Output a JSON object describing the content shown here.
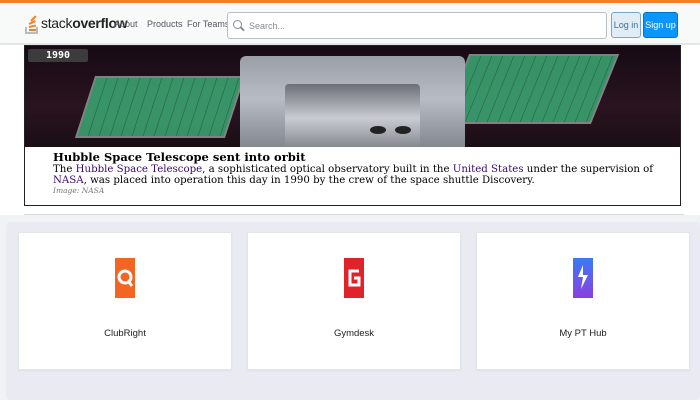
{
  "header": {
    "logo_text_light": "stack",
    "logo_text_bold": "overflow",
    "nav": [
      "About",
      "Products",
      "For Teams"
    ],
    "search_placeholder": "Search...",
    "login_label": "Log in",
    "signup_label": "Sign up"
  },
  "feature": {
    "year": "1990",
    "title": "Hubble Space Telescope sent into orbit",
    "body_pre": "The ",
    "body_link1": "Hubble Space Telescope",
    "body_mid1": ", a sophisticated optical observatory built in the ",
    "body_link2": "United States",
    "body_mid2": " under the supervision of ",
    "body_link3": "NASA",
    "body_post": ", was placed into operation this day in 1990 by the crew of the space shuttle Discovery.",
    "credit": "Image: NASA"
  },
  "cards": [
    {
      "name": "ClubRight",
      "icon": "clubright-logo-icon",
      "color": "#f26522"
    },
    {
      "name": "Gymdesk",
      "icon": "gymdesk-logo-icon",
      "color": "#e0222a"
    },
    {
      "name": "My PT Hub",
      "icon": "my-pt-hub-logo-icon",
      "color": "#6b4ce6"
    }
  ],
  "colors": {
    "accent": "#f48024",
    "primary_button": "#0a95ff"
  }
}
